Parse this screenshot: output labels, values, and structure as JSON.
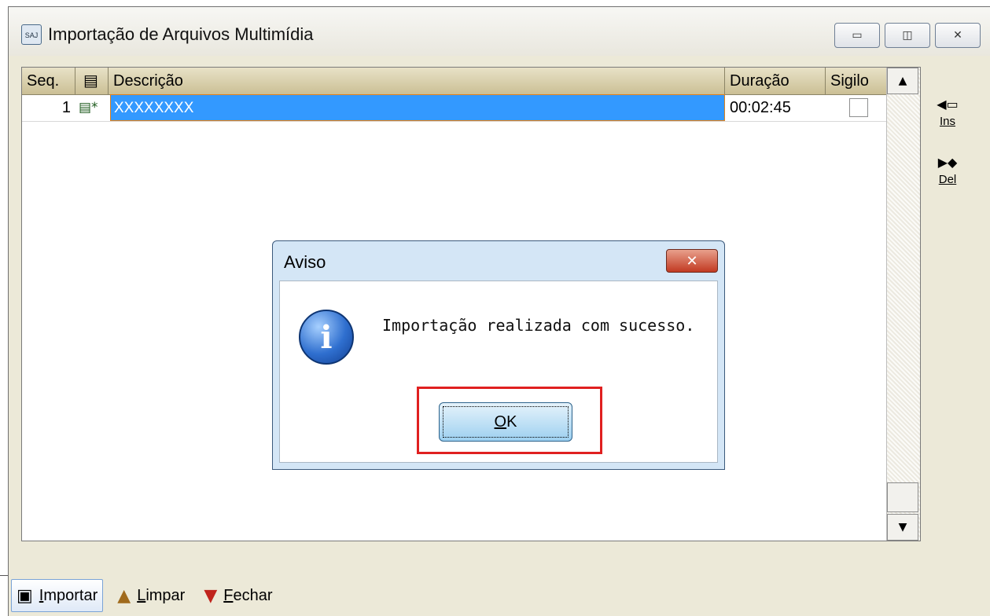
{
  "window": {
    "title": "Importação de Arquivos Multimídia",
    "app_icon": "SAJ",
    "controls": {
      "minimize": "▭",
      "maximize": "◫",
      "close": "✕"
    }
  },
  "grid": {
    "columns": {
      "seq": "Seq.",
      "media": "▤",
      "descricao": "Descrição",
      "duracao": "Duração",
      "sigilo": "Sigilo"
    },
    "rows": [
      {
        "seq": "1",
        "media_icon": "▤*",
        "descricao": "XXXXXXXX",
        "duracao": "00:02:45",
        "sigilo": false
      }
    ]
  },
  "scrollbar": {
    "up": "▲",
    "down": "▼"
  },
  "side_buttons": {
    "insert": {
      "icon": "◀▭",
      "label": "Ins"
    },
    "delete": {
      "icon": "▶◆",
      "label": "Del"
    }
  },
  "dialog": {
    "title": "Aviso",
    "close": "✕",
    "icon": "i",
    "message": "Importação realizada com sucesso.",
    "ok_accel": "O",
    "ok_rest": "K"
  },
  "toolbar": {
    "importar": {
      "icon": "▣",
      "accel": "I",
      "rest": "mportar"
    },
    "limpar": {
      "icon": "▲",
      "accel": "L",
      "rest": "impar"
    },
    "fechar": {
      "icon": "▼",
      "accel": "F",
      "rest": "echar"
    }
  }
}
